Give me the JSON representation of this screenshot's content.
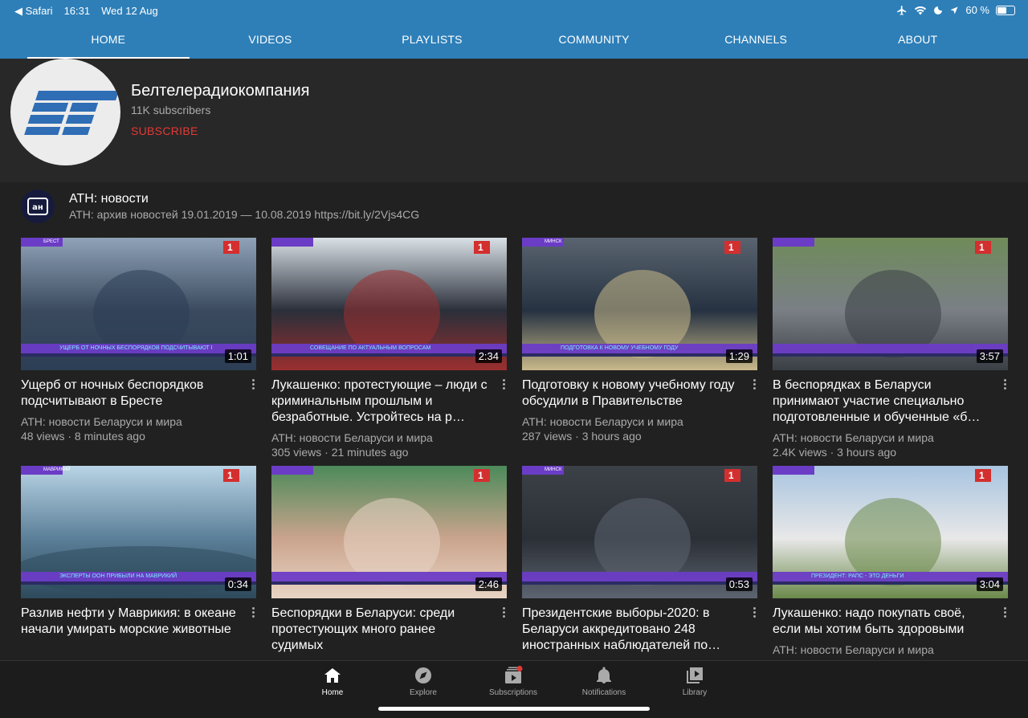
{
  "status_bar": {
    "back_app": "◀ Safari",
    "time": "16:31",
    "date": "Wed 12 Aug",
    "battery": "60 %",
    "battery_level": 0.6
  },
  "tabs": [
    "HOME",
    "VIDEOS",
    "PLAYLISTS",
    "COMMUNITY",
    "CHANNELS",
    "ABOUT"
  ],
  "channel": {
    "name": "Белтелерадиокомпания",
    "subscribers": "11K subscribers",
    "subscribe_label": "SUBSCRIBE"
  },
  "section": {
    "title": "АТН: новости",
    "subtitle": "АТН: архив новостей 19.01.2019 — 10.08.2019 https://bit.ly/2Vjs4CG"
  },
  "videos": [
    {
      "title": "Ущерб от ночных беспорядков подсчитывают в Бресте",
      "duration": "1:01",
      "channel": "АТН: новости Беларуси и мира",
      "stats": "48 views · 8 minutes ago",
      "ticker": "УЩЕРБ ОТ НОЧНЫХ БЕСПОРЯДКОВ ПОДСЧИТЫВАЮТ В БРЕСТЕ",
      "city": "БРЕСТ"
    },
    {
      "title": "Лукашенко: протестующие – люди с криминальным прошлым и безработные. Устройтесь на р…",
      "duration": "2:34",
      "channel": "АТН: новости Беларуси и мира",
      "stats": "305 views · 21 minutes ago",
      "ticker": "СОВЕЩАНИЕ ПО АКТУАЛЬНЫМ ВОПРОСАМ",
      "city": ""
    },
    {
      "title": "Подготовку к новому учебному году обсудили в Правительстве",
      "duration": "1:29",
      "channel": "АТН: новости Беларуси и мира",
      "stats": "287 views · 3 hours ago",
      "ticker": "ПОДГОТОВКА К НОВОМУ УЧЕБНОМУ ГОДУ",
      "city": "МИНСК"
    },
    {
      "title": "В беспорядках в Беларуси принимают участие специально подготовленные и обученные «б…",
      "duration": "3:57",
      "channel": "АТН: новости Беларуси и мира",
      "stats": "2.4K views · 3 hours ago",
      "ticker": "",
      "city": ""
    },
    {
      "title": "Разлив нефти у Маврикия: в океане начали умирать морские животные",
      "duration": "0:34",
      "channel": "",
      "stats": "",
      "ticker": "ЭКСПЕРТЫ ООН ПРИБЫЛИ НА МАВРИКИЙ",
      "city": "МАВРИКИЙ"
    },
    {
      "title": "Беспорядки в Беларуси: среди протестующих много ранее судимых",
      "duration": "2:46",
      "channel": "",
      "stats": "",
      "ticker": "",
      "city": ""
    },
    {
      "title": "Президентские выборы-2020: в Беларуси аккредитовано 248 иностранных наблюдателей по…",
      "duration": "0:53",
      "channel": "",
      "stats": "",
      "ticker": "",
      "city": "МИНСК"
    },
    {
      "title": "Лукашенко: надо покупать своё, если мы хотим быть здоровыми",
      "duration": "3:04",
      "channel": "АТН: новости Беларуси и мира",
      "stats": "",
      "ticker": "ПРЕЗИДЕНТ: РАПС - ЭТО ДЕНЬГИ",
      "city": ""
    }
  ],
  "bottom_nav": [
    "Home",
    "Explore",
    "Subscriptions",
    "Notifications",
    "Library"
  ],
  "colors": {
    "accent": "#2e7fb8",
    "background": "#212121",
    "subscribe": "#e53935",
    "ticker": "#6b3cc6"
  }
}
